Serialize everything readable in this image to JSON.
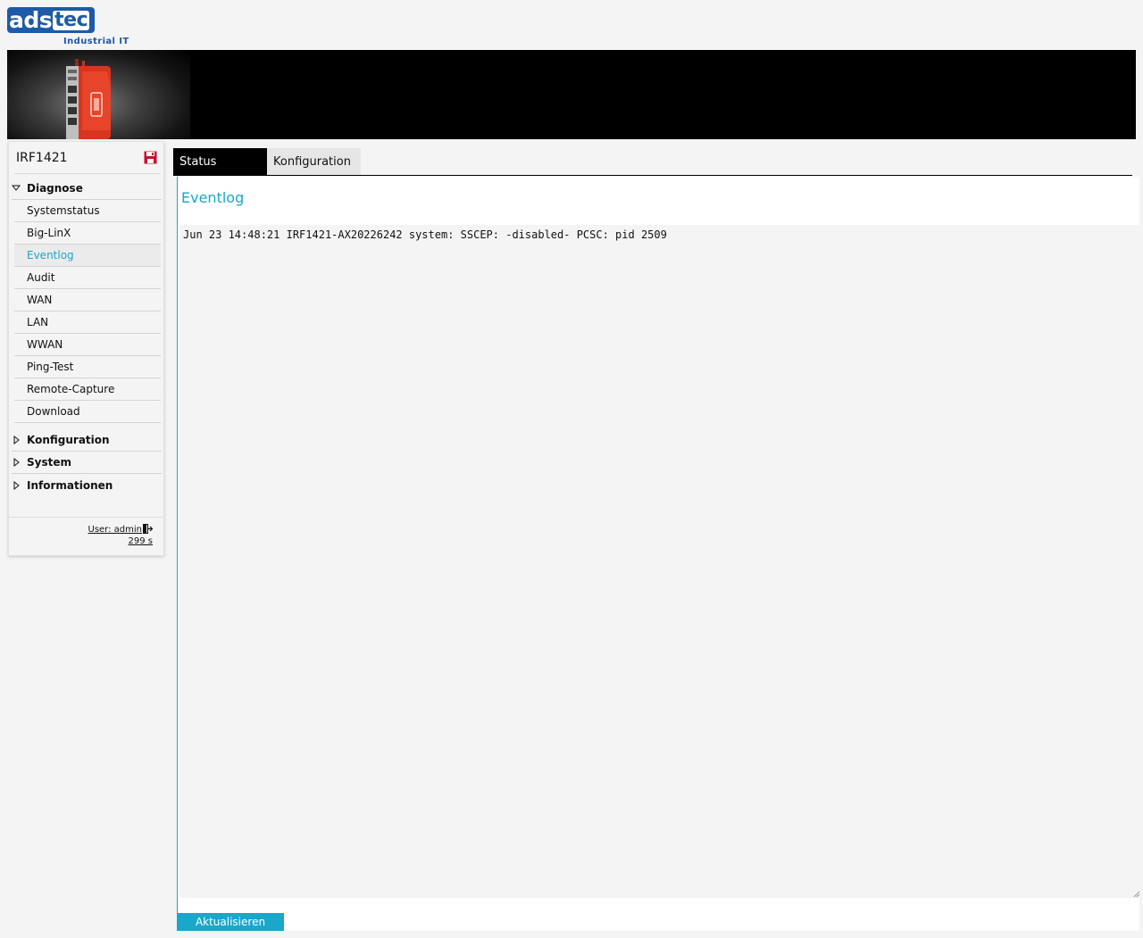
{
  "logo": {
    "brand_part1": "ads",
    "brand_part2": "tec",
    "tagline": "Industrial IT"
  },
  "colors": {
    "accent": "#1aa7c9",
    "brand": "#1d5aa8",
    "icon_red": "#c8102e"
  },
  "sidebar": {
    "device_title": "IRF1421",
    "save_icon": "save-icon",
    "groups": {
      "diagnose": "Diagnose",
      "konfiguration": "Konfiguration",
      "system": "System",
      "informationen": "Informationen"
    },
    "diagnose_items": [
      "Systemstatus",
      "Big-LinX",
      "Eventlog",
      "Audit",
      "WAN",
      "LAN",
      "WWAN",
      "Ping-Test",
      "Remote-Capture",
      "Download"
    ],
    "active_item": "Eventlog",
    "user_link": "User: admin",
    "timer": "299 s"
  },
  "tabs": {
    "status": "Status",
    "konfiguration": "Konfiguration",
    "active": "Status"
  },
  "main": {
    "title": "Eventlog",
    "log_text": "Jun 23 14:48:21 IRF1421-AX20226242 system: SSCEP: -disabled- PCSC: pid 2509",
    "refresh_button": "Aktualisieren"
  }
}
